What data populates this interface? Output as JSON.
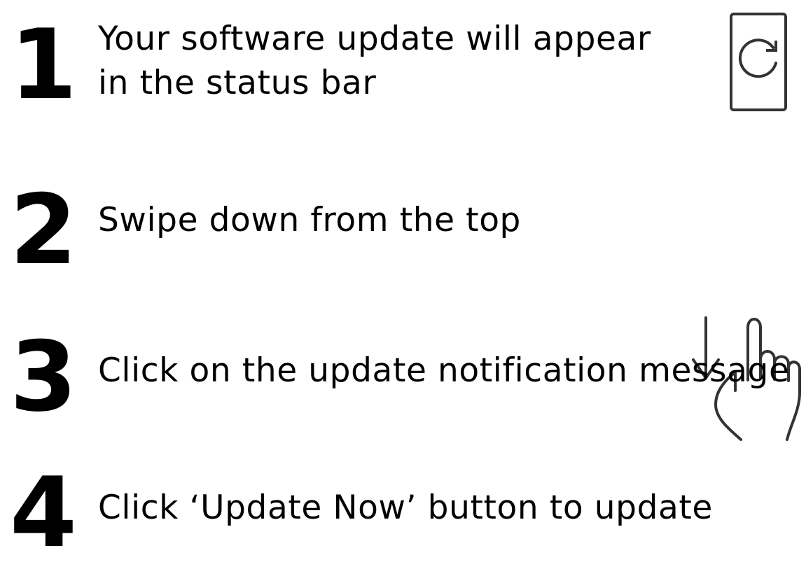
{
  "steps": [
    {
      "number": "1",
      "text_lines": [
        "Your software update will appear",
        "in the status bar"
      ],
      "icon": "phone-refresh-icon"
    },
    {
      "number": "2",
      "text_lines": [
        "Swipe down from the top"
      ],
      "icon": "swipe-down-hand-icon"
    },
    {
      "number": "3",
      "text_lines": [
        "Click on the update notification message"
      ]
    },
    {
      "number": "4",
      "text_lines": [
        "Click ‘Update Now’ button to update"
      ]
    }
  ],
  "colors": {
    "text": "#000000",
    "icon_stroke": "#333333",
    "background": "#ffffff"
  }
}
